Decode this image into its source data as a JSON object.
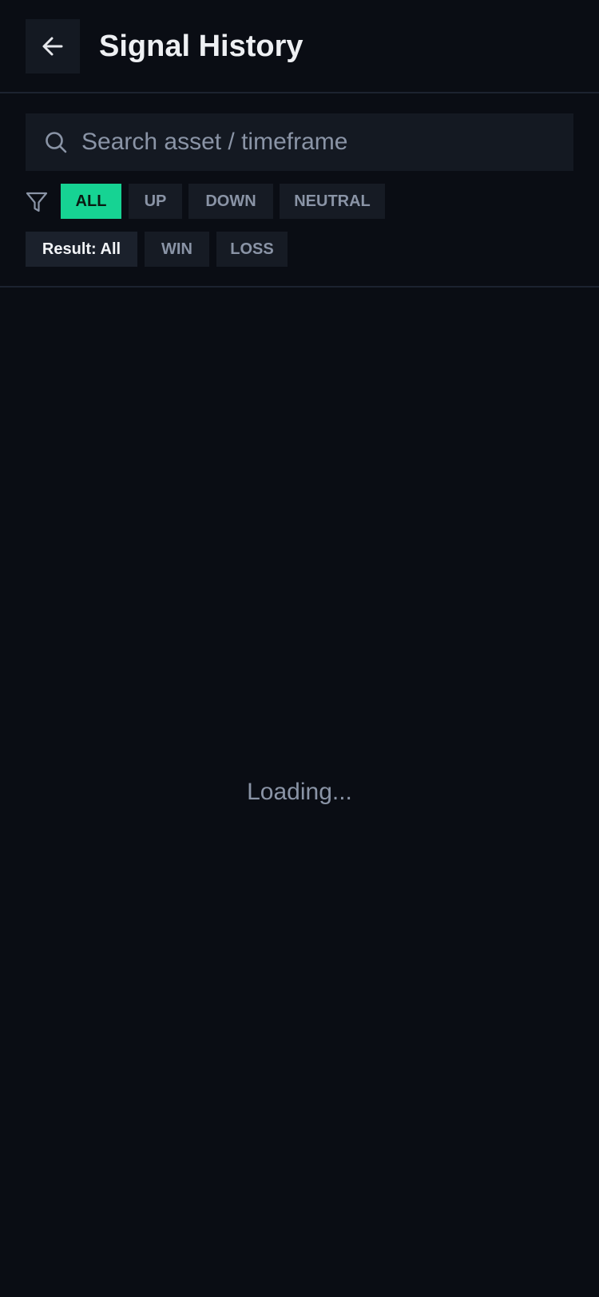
{
  "header": {
    "title": "Signal History",
    "back_icon": "arrow-left-icon"
  },
  "search": {
    "placeholder": "Search asset / timeframe",
    "value": "",
    "icon": "search-icon"
  },
  "direction_filter": {
    "icon": "filter-icon",
    "options": [
      {
        "label": "ALL",
        "active": true
      },
      {
        "label": "UP",
        "active": false
      },
      {
        "label": "DOWN",
        "active": false
      },
      {
        "label": "NEUTRAL",
        "active": false
      }
    ]
  },
  "result_filter": {
    "options": [
      {
        "label": "Result: All",
        "active": true
      },
      {
        "label": "WIN",
        "active": false
      },
      {
        "label": "LOSS",
        "active": false
      }
    ]
  },
  "content": {
    "status_text": "Loading..."
  },
  "colors": {
    "background": "#0a0d14",
    "accent": "#16d393",
    "chip": "#161b24",
    "muted_text": "#8a94a6"
  }
}
